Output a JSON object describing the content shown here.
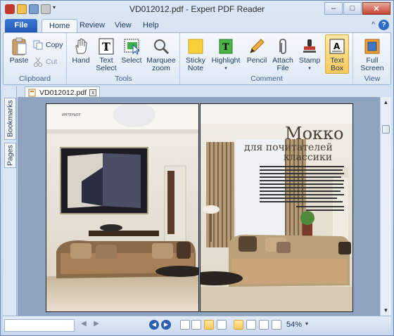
{
  "window": {
    "title": "VD012012.pdf - Expert PDF Reader"
  },
  "tabs": [
    {
      "label": "File"
    },
    {
      "label": "Home"
    },
    {
      "label": "Review"
    },
    {
      "label": "View"
    },
    {
      "label": "Help"
    }
  ],
  "ribbon": {
    "clipboard": {
      "label": "Clipboard",
      "paste": "Paste",
      "copy": "Copy",
      "cut": "Cut"
    },
    "tools": {
      "label": "Tools",
      "hand": "Hand",
      "text_select": "Text Select",
      "select": "Select",
      "marquee_zoom": "Marquee zoom"
    },
    "comment": {
      "label": "Comment",
      "sticky_note": "Sticky Note",
      "highlight": "Highlight",
      "pencil": "Pencil",
      "attach_file": "Attach File",
      "stamp": "Stamp",
      "text_box": "Text Box"
    },
    "view": {
      "label": "View",
      "full_screen": "Full Screen"
    }
  },
  "sidebar": {
    "bookmarks": "Bookmarks",
    "pages": "Pages"
  },
  "document": {
    "tab_name": "VD012012.pdf",
    "close": "x"
  },
  "magazine": {
    "header": "ИНТЕРЬЕР",
    "title_line1": "Мокко",
    "title_line2": "для почитателей",
    "title_line3": "классики"
  },
  "status": {
    "zoom": "54%"
  },
  "colors": {
    "accent": "#1f55b3",
    "selected": "#f8c85b"
  }
}
